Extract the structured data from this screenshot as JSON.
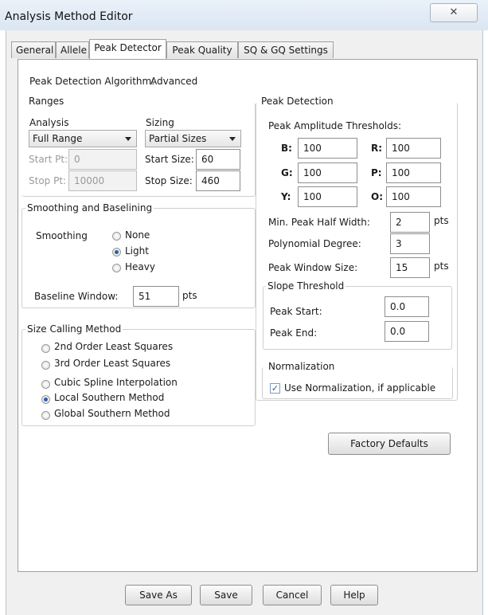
{
  "window": {
    "title": "Analysis Method Editor",
    "close_glyph": "✕"
  },
  "tabs": [
    "General",
    "Allele",
    "Peak Detector",
    "Peak Quality",
    "SQ & GQ Settings"
  ],
  "algorithm": {
    "label": "Peak Detection Algorithm:",
    "value": "Advanced"
  },
  "ranges": {
    "title": "Ranges",
    "analysis_label": "Analysis",
    "analysis_value": "Full Range",
    "start_pt_label": "Start Pt:",
    "start_pt_value": "0",
    "stop_pt_label": "Stop Pt:",
    "stop_pt_value": "10000",
    "sizing_label": "Sizing",
    "sizing_value": "Partial Sizes",
    "start_size_label": "Start Size:",
    "start_size_value": "60",
    "stop_size_label": "Stop Size:",
    "stop_size_value": "460"
  },
  "smoothing": {
    "title": "Smoothing and Baselining",
    "label": "Smoothing",
    "options": [
      "None",
      "Light",
      "Heavy"
    ],
    "selected": "Light",
    "baseline_label": "Baseline Window:",
    "baseline_value": "51",
    "baseline_unit": "pts"
  },
  "size_calling": {
    "title": "Size Calling Method",
    "options": [
      "2nd Order Least Squares",
      "3rd Order Least Squares",
      "Cubic Spline Interpolation",
      "Local Southern Method",
      "Global Southern Method"
    ],
    "selected": "Local Southern Method"
  },
  "peak_detection": {
    "title": "Peak Detection",
    "amplitude_label": "Peak Amplitude Thresholds:",
    "thresholds": {
      "B": "100",
      "R": "100",
      "G": "100",
      "P": "100",
      "Y": "100",
      "O": "100"
    },
    "keys": {
      "B": "B:",
      "R": "R:",
      "G": "G:",
      "P": "P:",
      "Y": "Y:",
      "O": "O:"
    },
    "min_half_width_label": "Min. Peak Half Width:",
    "min_half_width_value": "2",
    "poly_degree_label": "Polynomial Degree:",
    "poly_degree_value": "3",
    "window_size_label": "Peak Window Size:",
    "window_size_value": "15",
    "unit": "pts"
  },
  "slope": {
    "title": "Slope Threshold",
    "start_label": "Peak Start:",
    "start_value": "0.0",
    "end_label": "Peak End:",
    "end_value": "0.0"
  },
  "normalization": {
    "title": "Normalization",
    "checkbox_label": "Use Normalization, if applicable",
    "checked": true
  },
  "buttons": {
    "factory_defaults": "Factory Defaults",
    "save_as": "Save As",
    "save": "Save",
    "cancel": "Cancel",
    "help": "Help"
  }
}
